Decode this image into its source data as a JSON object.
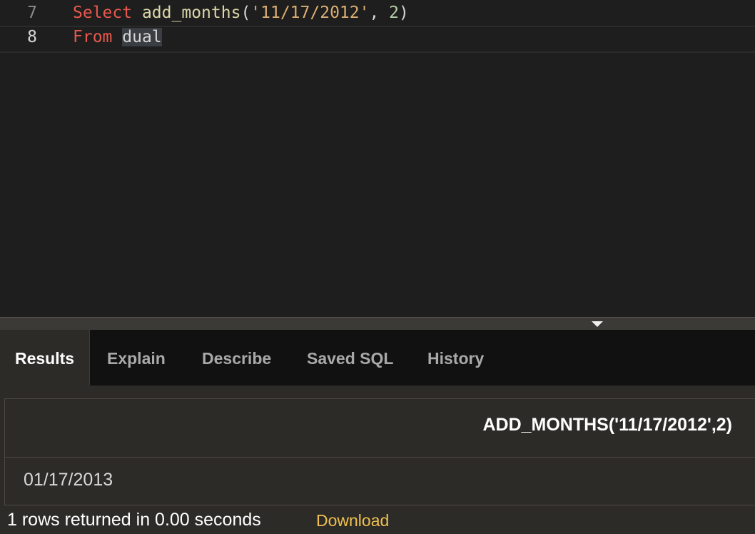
{
  "editor": {
    "lines": [
      {
        "number": "7",
        "tokens": {
          "kw": "Select",
          "sp": " ",
          "fn": "add_months",
          "open": "(",
          "str": "'11/17/2012'",
          "comma": ", ",
          "num": "2",
          "close": ")"
        }
      },
      {
        "number": "8",
        "tokens": {
          "kw": "From",
          "sp": " ",
          "table": "dual"
        }
      }
    ]
  },
  "tabs": [
    {
      "label": "Results",
      "active": true
    },
    {
      "label": "Explain"
    },
    {
      "label": "Describe"
    },
    {
      "label": "Saved SQL"
    },
    {
      "label": "History"
    }
  ],
  "results": {
    "columns": [
      "ADD_MONTHS('11/17/2012',2)"
    ],
    "rows": [
      [
        "01/17/2013"
      ]
    ],
    "status": "1 rows returned in 0.00 seconds",
    "download_label": "Download"
  },
  "colors": {
    "background": "#1e1e1e",
    "keyword": "#e8584c",
    "string": "#dcae72",
    "link": "#f0c04e"
  }
}
